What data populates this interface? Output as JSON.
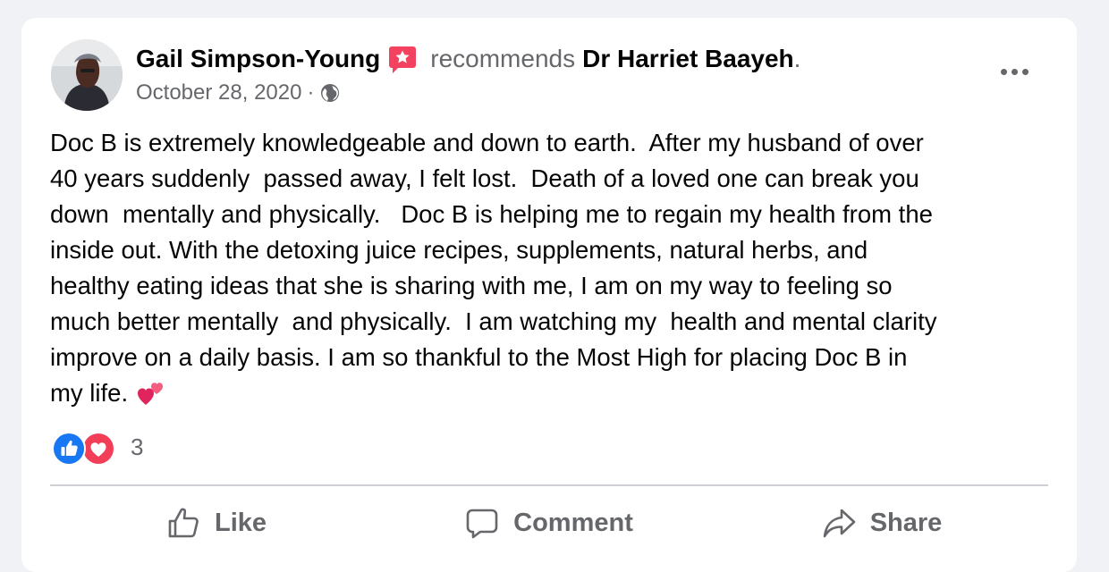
{
  "post": {
    "author": "Gail Simpson-Young",
    "recommends_word": "recommends",
    "target": "Dr Harriet Baayeh",
    "target_period": ".",
    "date": "October 28, 2020",
    "date_separator": "·",
    "privacy_icon": "globe-icon",
    "badge_icon": "recommendation-star-icon",
    "more_icon": "more-options-icon",
    "text_lines": [
      "Doc B is extremely knowledgeable and down to earth.  After my husband of over",
      "40 years suddenly  passed away, I felt lost.  Death of a loved one can break you",
      "down  mentally and physically.   Doc B is helping me to regain my health from the",
      "inside out. With the detoxing juice recipes, supplements, natural herbs, and",
      "healthy eating ideas that she is sharing with me, I am on my way to feeling so",
      "much better mentally  and physically.  I am watching my  health and mental clarity",
      "improve on a daily basis. I am so thankful to the Most High for placing Doc B in",
      "my life. "
    ],
    "trailing_emoji": "two-hearts-emoji"
  },
  "reactions": {
    "icons": [
      "like-reaction-icon",
      "love-reaction-icon"
    ],
    "count": "3"
  },
  "actions": {
    "like": "Like",
    "comment": "Comment",
    "share": "Share"
  },
  "colors": {
    "background": "#f0f2f5",
    "card": "#ffffff",
    "primary_text": "#050505",
    "secondary_text": "#65676b",
    "like_blue": "#1877f2",
    "love_red": "#f33e58",
    "badge_pink": "#f3425f"
  }
}
